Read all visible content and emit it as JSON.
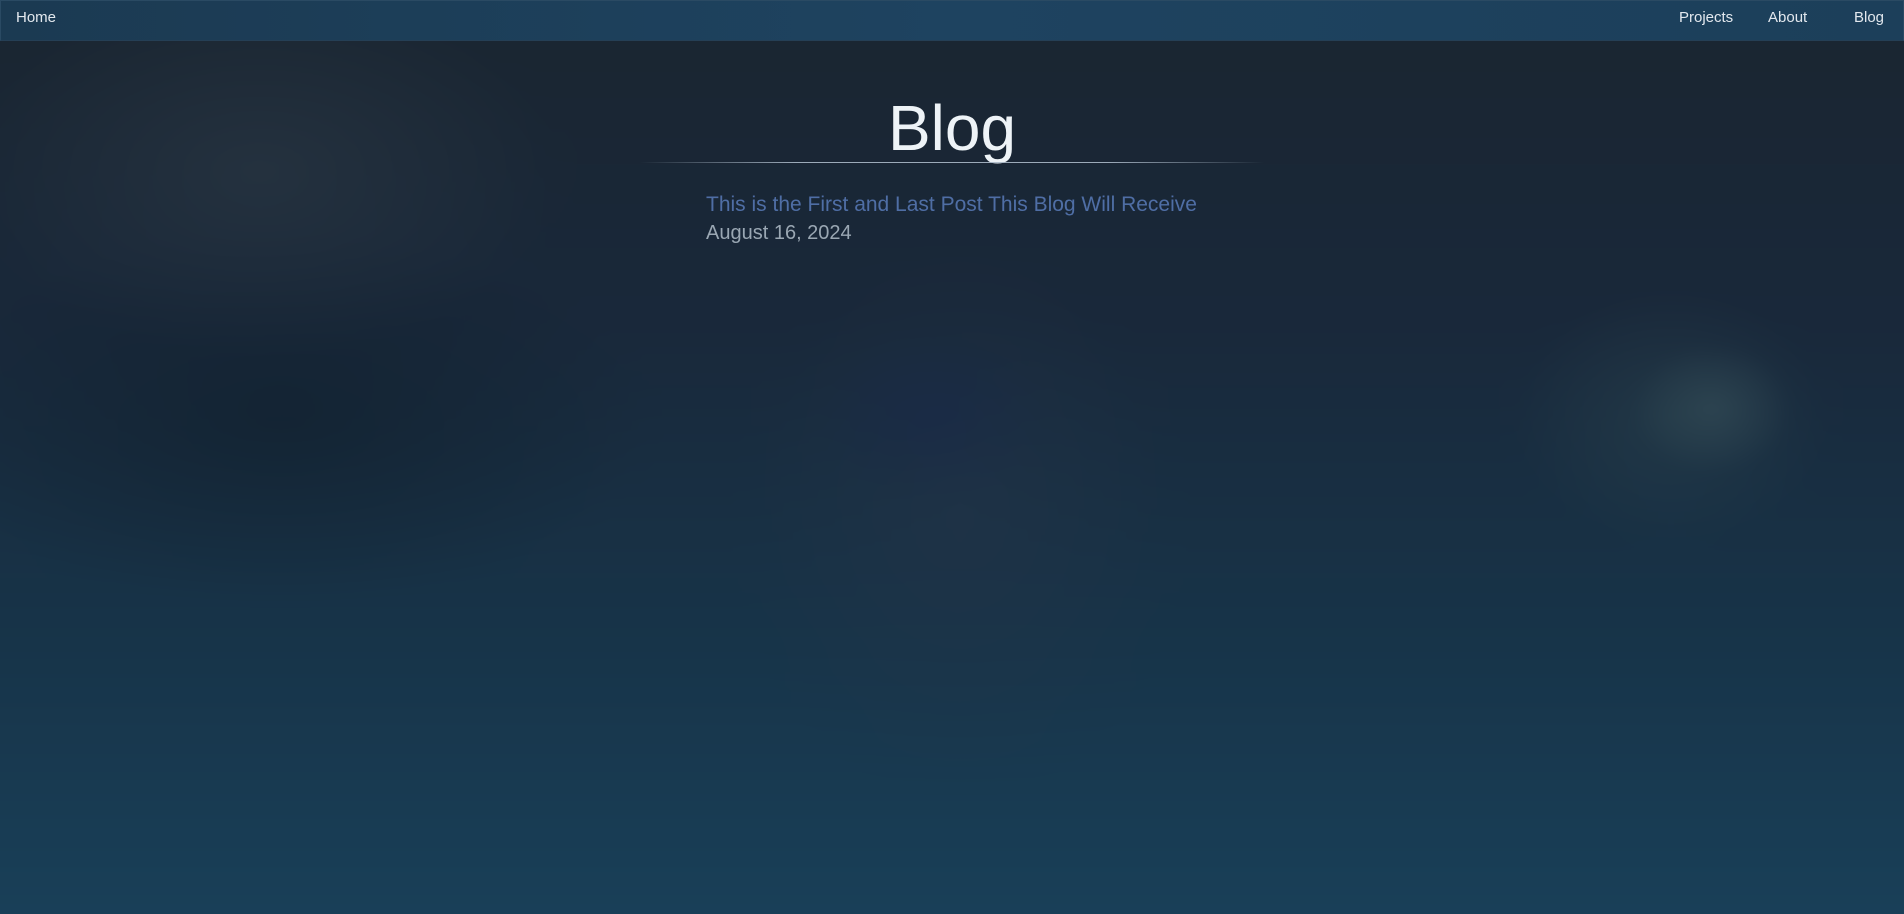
{
  "nav": {
    "home_label": "Home",
    "projects_label": "Projects",
    "about_label": "About",
    "blog_label": "Blog"
  },
  "main": {
    "page_title": "Blog",
    "posts": [
      {
        "title": "This is the First and Last Post This Blog Will Receive",
        "date": "August 16, 2024"
      }
    ]
  },
  "colors": {
    "nav_background": "#1e4360",
    "title_text": "#eef3f7",
    "post_link": "#4f6ea5",
    "post_date": "#9aa7b3"
  }
}
